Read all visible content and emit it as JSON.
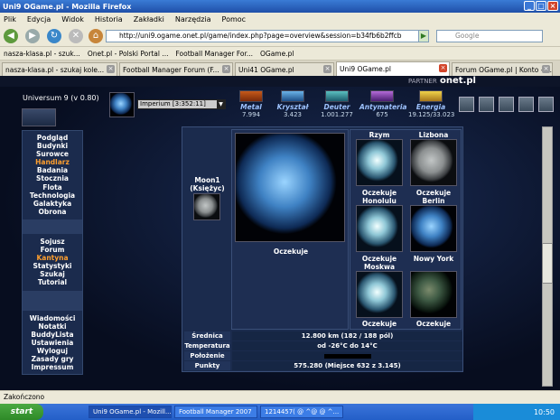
{
  "window": {
    "title": "Uni9 OGame.pl - Mozilla Firefox"
  },
  "menu": {
    "items": [
      "Plik",
      "Edycja",
      "Widok",
      "Historia",
      "Zakładki",
      "Narzędzia",
      "Pomoc"
    ]
  },
  "nav": {
    "url": "http://uni9.ogame.onet.pl/game/index.php?page=overview&session=b34fb6b2ffcb",
    "search_placeholder": "Google"
  },
  "bookmarks": [
    "nasza-klasa.pl - szuk...",
    "Onet.pl - Polski Portal ...",
    "Football Manager For...",
    "OGame.pl"
  ],
  "tabs": [
    {
      "label": "nasza-klasa.pl - szukaj kole...",
      "active": false
    },
    {
      "label": "Football Manager Forum (F...",
      "active": false
    },
    {
      "label": "Uni41 OGame.pl",
      "active": false
    },
    {
      "label": "Uni9 OGame.pl",
      "active": true
    },
    {
      "label": "Forum OGame.pl | Konto - ...",
      "active": false
    }
  ],
  "partner": {
    "label": "PARTNER",
    "logo": "onet.pl"
  },
  "universe": "Universum 9 (v 0.80)",
  "planet_select": {
    "value": "Imperium [3:352:11]"
  },
  "resources": [
    {
      "name": "Metal",
      "value": "7.994",
      "icon": "metal-icon"
    },
    {
      "name": "Kryształ",
      "value": "3.423",
      "icon": "crystal-icon"
    },
    {
      "name": "Deuter",
      "value": "1.001.277",
      "icon": "deuterium-icon"
    },
    {
      "name": "Antymateria",
      "value": "675",
      "icon": "antimatter-icon"
    },
    {
      "name": "Energia",
      "value": "19.125/33.023",
      "icon": "energy-icon"
    }
  ],
  "leftmenu": {
    "group1": [
      {
        "label": "Podgląd",
        "hl": false
      },
      {
        "label": "Budynki",
        "hl": false
      },
      {
        "label": "Surowce",
        "hl": false
      },
      {
        "label": "Handlarz",
        "hl": true
      },
      {
        "label": "Badania",
        "hl": false
      },
      {
        "label": "Stocznia",
        "hl": false
      },
      {
        "label": "Flota",
        "hl": false
      },
      {
        "label": "Technologia",
        "hl": false
      },
      {
        "label": "Galaktyka",
        "hl": false
      },
      {
        "label": "Obrona",
        "hl": false
      }
    ],
    "group2": [
      {
        "label": "Sojusz",
        "hl": false
      },
      {
        "label": "Forum",
        "hl": false
      },
      {
        "label": "Kantyna",
        "hl": true
      },
      {
        "label": "Statystyki",
        "hl": false
      },
      {
        "label": "Szukaj",
        "hl": false
      },
      {
        "label": "Tutorial",
        "hl": false
      }
    ],
    "group3": [
      {
        "label": "Wiadomości",
        "hl": false
      },
      {
        "label": "Notatki",
        "hl": false
      },
      {
        "label": "BuddyLista",
        "hl": false
      },
      {
        "label": "Ustawienia",
        "hl": false
      },
      {
        "label": "Wyloguj",
        "hl": false
      },
      {
        "label": "Zasady gry",
        "hl": false
      },
      {
        "label": "Impressum",
        "hl": false
      }
    ]
  },
  "moon": {
    "name": "Moon1",
    "sub": "(Księżyc)"
  },
  "main_planet": {
    "status": "Oczekuje"
  },
  "colonies": [
    {
      "name": "Rzym",
      "status": "Oczekuje",
      "style": "earth"
    },
    {
      "name": "Lizbona",
      "status": "Oczekuje",
      "style": "moon"
    },
    {
      "name": "Honolulu",
      "status": "Oczekuje",
      "style": "earth"
    },
    {
      "name": "Berlin",
      "status": "Nowy York",
      "style": "blue"
    },
    {
      "name": "Moskwa",
      "status": "Oczekuje",
      "style": "earth"
    },
    {
      "name": "",
      "status": "Oczekuje",
      "style": "dark"
    }
  ],
  "info": [
    {
      "key": "Średnica",
      "value": "12.800 km (182 / 188 pól)"
    },
    {
      "key": "Temperatura",
      "value": "od -26°C do 14°C"
    },
    {
      "key": "Położenie",
      "value": ""
    },
    {
      "key": "Punkty",
      "value": "575.280 (Miejsce 632 z 3.145)"
    }
  ],
  "status": "Zakończono",
  "taskbar": {
    "start": "start",
    "tasks": [
      {
        "label": "Uni9 OGame.pl - Mozill...",
        "active": true
      },
      {
        "label": "Football Manager 2007",
        "active": false
      },
      {
        "label": "1214457( @ ^@ @ ^...",
        "active": false
      }
    ],
    "clock": "10:50"
  }
}
